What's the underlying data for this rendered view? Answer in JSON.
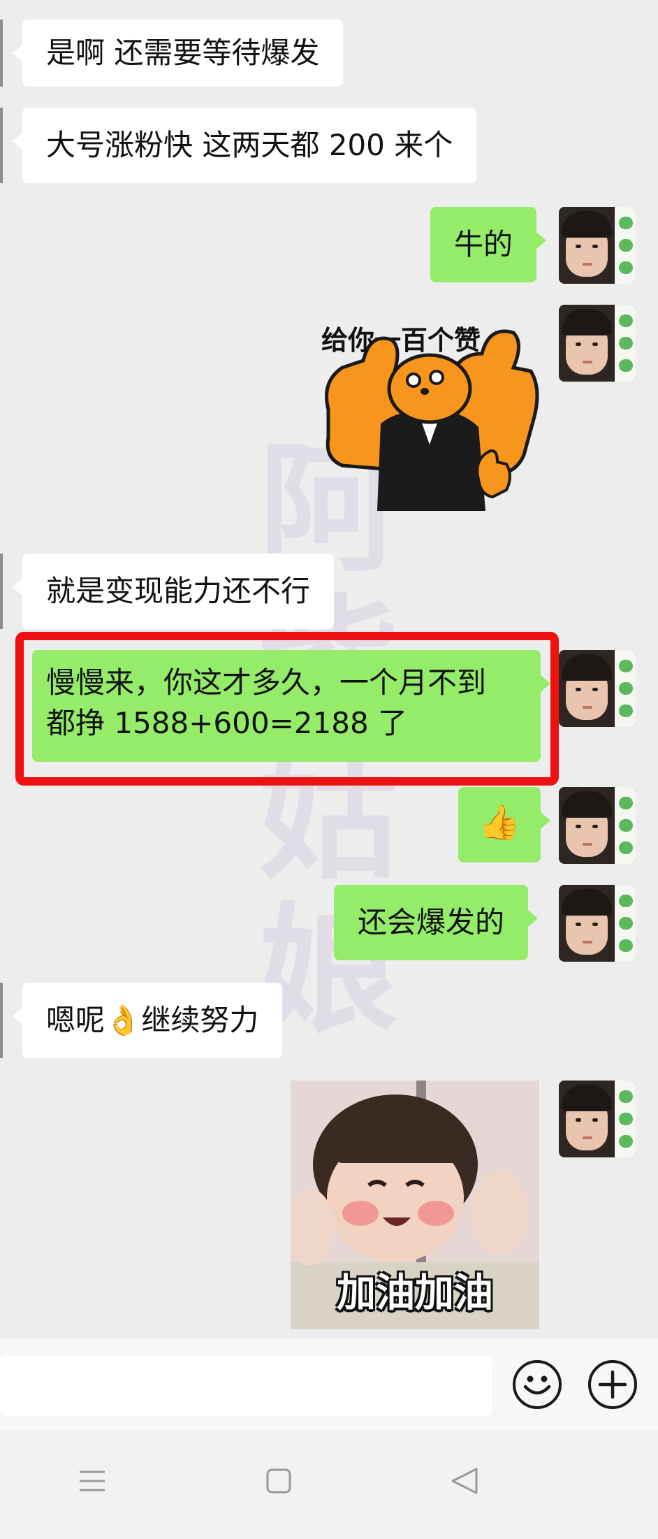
{
  "messages": [
    {
      "side": "incoming",
      "text": "是啊 还需要等待爆发"
    },
    {
      "side": "incoming",
      "text": "大号涨粉快 这两天都 200 来个"
    },
    {
      "side": "outgoing",
      "text": "牛的"
    },
    {
      "side": "outgoing",
      "type": "sticker",
      "sticker_text": "给你一百个赞",
      "icon": "thumbs-up-bear-sticker"
    },
    {
      "side": "incoming",
      "text": "就是变现能力还不行"
    },
    {
      "side": "outgoing",
      "text_line1": "慢慢来，你这才多久，一个月不到",
      "text_line2": "都挣 1588+600=2188 了",
      "highlighted": true
    },
    {
      "side": "outgoing",
      "type": "emoji",
      "emoji": "👍"
    },
    {
      "side": "outgoing",
      "text": "还会爆发的"
    },
    {
      "side": "incoming",
      "text_before": "嗯呢",
      "emoji": "👌",
      "text_after": "继续努力"
    },
    {
      "side": "outgoing",
      "type": "sticker",
      "sticker_text": "加油加油",
      "icon": "baby-cheer-sticker"
    }
  ],
  "watermark": "阿紫姑娘",
  "colors": {
    "chat_background": "#ededed",
    "outgoing_bubble": "#95ec69",
    "incoming_bubble": "#ffffff",
    "highlight_frame": "#ee1111"
  },
  "input_bar": {
    "emoji_button_icon": "smiley-icon",
    "add_button_icon": "plus-circle-icon"
  },
  "nav_bar": {
    "menu_icon": "menu-icon",
    "home_icon": "home-square-icon",
    "back_icon": "back-triangle-icon"
  }
}
